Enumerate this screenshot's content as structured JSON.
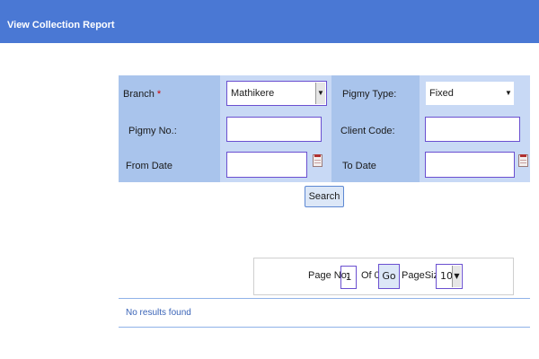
{
  "header": {
    "title": "View Collection Report",
    "bg_color": "#4a78d4"
  },
  "form": {
    "branch_label": "Branch",
    "required_mark": "*",
    "branch_value": "Mathikere",
    "pigmy_type_label": "Pigmy Type:",
    "pigmy_type_value": "Fixed",
    "pigmy_no_label": "Pigmy No.:",
    "pigmy_no_value": "",
    "client_code_label": "Client Code:",
    "client_code_value": "",
    "from_date_label": "From Date",
    "from_date_value": "",
    "to_date_label": "To Date",
    "to_date_value": "",
    "search_label": "Search"
  },
  "pager": {
    "page_no_label": "Page No:",
    "page_no_value": "1",
    "of_label": "Of 0",
    "go_label": "Go",
    "page_size_label": "PageSize:",
    "page_size_value": "10"
  },
  "results": {
    "message": "No results found"
  },
  "icons": {
    "dropdown": "chevron-down-icon",
    "calendar": "calendar-icon"
  }
}
